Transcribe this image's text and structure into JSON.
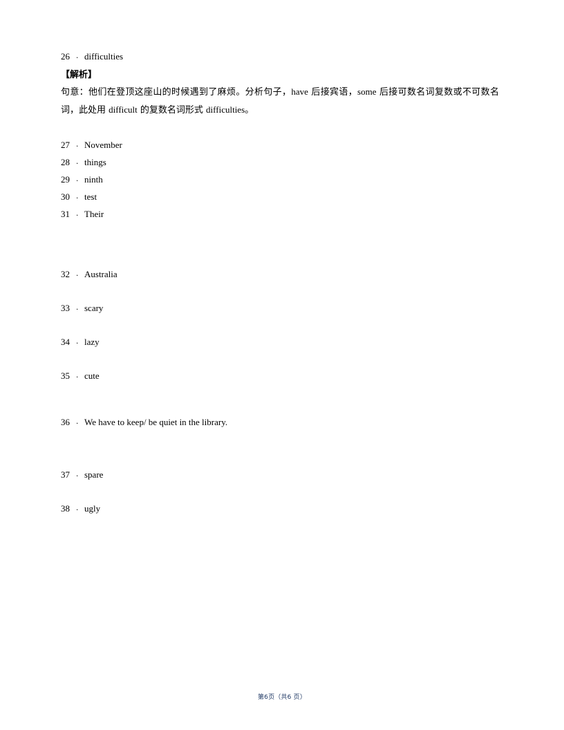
{
  "document": {
    "page_label": "第6页（共6 页）",
    "footer_color": "#1f3864",
    "text_color": "#000000",
    "background_color": "#ffffff"
  },
  "separator": "．",
  "answers_top": [
    {
      "number": "26",
      "value": "difficulties"
    }
  ],
  "analysis": {
    "label": "【解析】",
    "line1_prefix": "句意：他们在登顶这座山的时候遇到了麻烦。分析句子，",
    "term1": "have",
    "line1_mid": " 后接宾语，",
    "term2": "some",
    "line1_suffix": " 后接可数名词复数或不可数名词，此处用 ",
    "term3": "difficult",
    "line2_mid": " 的复数名词形式 ",
    "term4": "difficulties",
    "line2_suffix": "。"
  },
  "answers_group_tight": [
    {
      "number": "27",
      "value": "November"
    },
    {
      "number": "28",
      "value": "things"
    },
    {
      "number": "29",
      "value": "ninth"
    },
    {
      "number": "30",
      "value": "test"
    },
    {
      "number": "31",
      "value": "Their"
    }
  ],
  "answers_group_loose_a": [
    {
      "number": "32",
      "value": "Australia"
    },
    {
      "number": "33",
      "value": "scary"
    },
    {
      "number": "34",
      "value": "lazy"
    },
    {
      "number": "35",
      "value": "cute"
    }
  ],
  "answers_group_sentence": [
    {
      "number": "36",
      "value": "We have to keep/ be quiet in the library."
    }
  ],
  "answers_group_loose_b": [
    {
      "number": "37",
      "value": "spare"
    },
    {
      "number": "38",
      "value": "ugly"
    }
  ]
}
